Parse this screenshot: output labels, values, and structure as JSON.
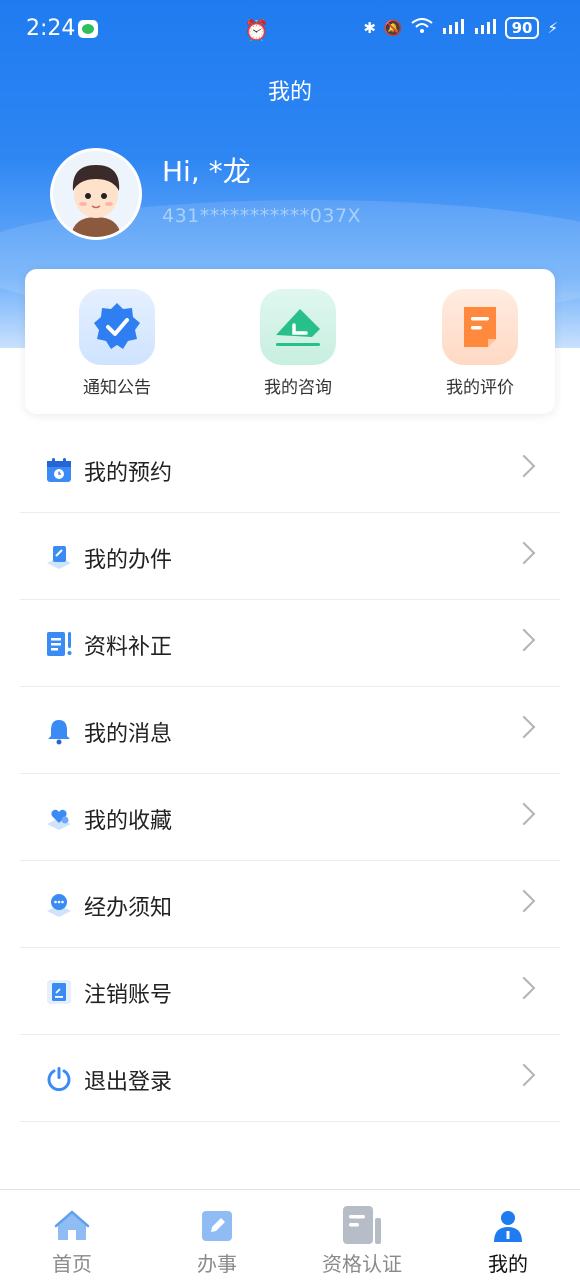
{
  "status_bar": {
    "time": "2:24",
    "battery": "90"
  },
  "header": {
    "title": "我的"
  },
  "user": {
    "greeting": "Hi, *龙",
    "id_masked": "431***********037X"
  },
  "quick_actions": [
    {
      "label": "通知公告",
      "icon": "verified-badge-icon"
    },
    {
      "label": "我的咨询",
      "icon": "consult-envelope-icon"
    },
    {
      "label": "我的评价",
      "icon": "review-note-icon"
    }
  ],
  "menu": [
    {
      "label": "我的预约",
      "icon": "calendar-clock-icon"
    },
    {
      "label": "我的办件",
      "icon": "document-edit-icon"
    },
    {
      "label": "资料补正",
      "icon": "document-alert-icon"
    },
    {
      "label": "我的消息",
      "icon": "bell-icon"
    },
    {
      "label": "我的收藏",
      "icon": "heart-favorite-icon"
    },
    {
      "label": "经办须知",
      "icon": "chat-bubble-icon"
    },
    {
      "label": "注销账号",
      "icon": "account-cancel-icon"
    },
    {
      "label": "退出登录",
      "icon": "power-icon"
    }
  ],
  "tabbar": [
    {
      "label": "首页",
      "icon": "home-icon"
    },
    {
      "label": "办事",
      "icon": "edit-task-icon"
    },
    {
      "label": "资格认证",
      "icon": "certification-icon"
    },
    {
      "label": "我的",
      "icon": "person-icon"
    }
  ],
  "colors": {
    "primary": "#1f7bf0",
    "accent_green": "#27c08a",
    "accent_orange": "#ff8a3d"
  }
}
